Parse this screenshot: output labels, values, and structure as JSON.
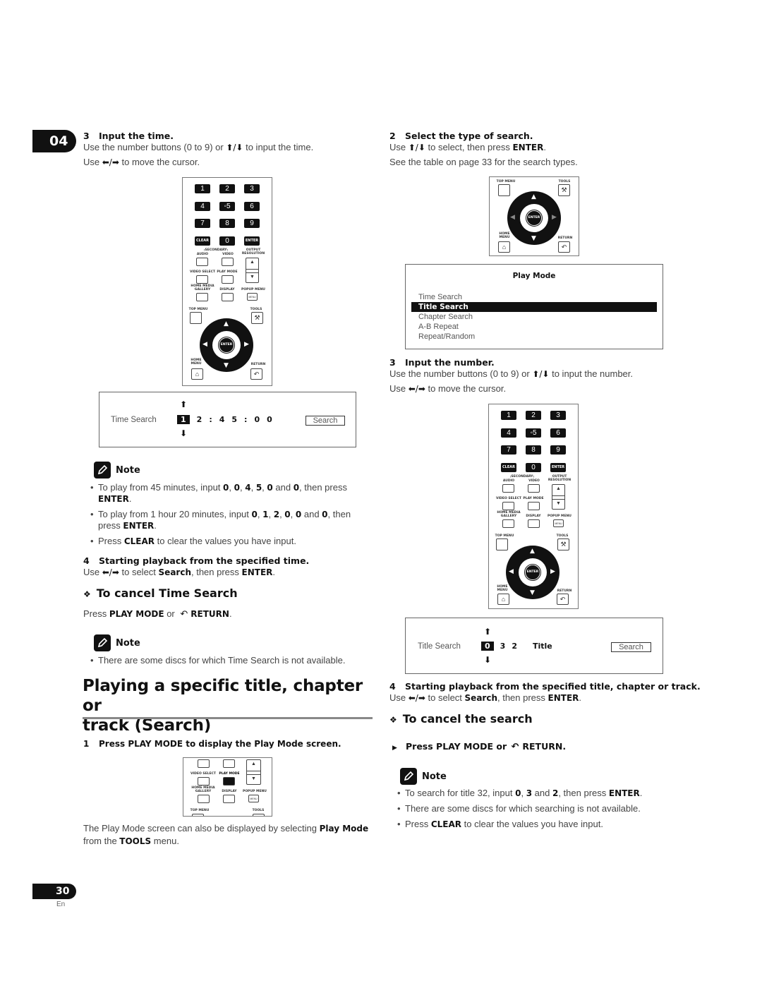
{
  "chapter": "04",
  "page": {
    "number": "30",
    "lang": "En"
  },
  "left": {
    "step3": {
      "num": "3",
      "title": "Input the time.",
      "line1_pre": "Use the number buttons (0 to 9) or ",
      "line1_arrows": "🠉/🠋",
      "line1_post": " to input the time.",
      "line2_pre": "Use ",
      "line2_arrows": "⬅/➡",
      "line2_post": " to move the cursor."
    },
    "time_screen": {
      "label": "Time Search",
      "digits": [
        "1",
        "2",
        ":",
        "4",
        "5",
        ":",
        "0",
        "0"
      ],
      "selected_index": 0,
      "up_arrow": "⬆",
      "down_arrow": "⬇",
      "button": "Search"
    },
    "note1": {
      "heading": "Note",
      "items": [
        [
          "To play from 45 minutes, input ",
          "0",
          ", ",
          "0",
          ", ",
          "4",
          ", ",
          "5",
          ", ",
          "0",
          " and ",
          "0",
          ", then press ",
          "ENTER",
          "."
        ],
        [
          "To play from 1 hour 20 minutes, input ",
          "0",
          ", ",
          "1",
          ", ",
          "2",
          ", ",
          "0",
          ", ",
          "0",
          " and ",
          "0",
          ", then press ",
          "ENTER",
          "."
        ],
        [
          "Press ",
          "CLEAR",
          " to clear the values you have input."
        ]
      ]
    },
    "step4": {
      "num": "4",
      "title": "Starting playback from the specified time.",
      "pre": "Use ",
      "arrows": "⬅/➡",
      "mid": " to select ",
      "b1": "Search",
      "mid2": ", then press ",
      "b2": "ENTER",
      "post": "."
    },
    "cancel": {
      "diamond": "❖",
      "heading": "To cancel Time Search",
      "pre": "Press ",
      "b1": "PLAY MODE",
      "mid": " or ",
      "b2": "RETURN",
      "post": "."
    },
    "note2": {
      "heading": "Note",
      "items": [
        [
          "There are some discs for which Time Search is not available."
        ]
      ]
    },
    "section_title_line1": "Playing a specific title, chapter or",
    "section_title_line2": "track (Search)",
    "step1": {
      "num": "1",
      "title": "Press PLAY MODE to display the Play Mode screen."
    },
    "footer_pre": "The Play Mode screen can also be displayed by selecting ",
    "footer_b1": "Play Mode",
    "footer_mid": " from the ",
    "footer_b2": "TOOLS",
    "footer_post": " menu."
  },
  "right": {
    "step2": {
      "num": "2",
      "title": "Select the type of search.",
      "pre": "Use ",
      "arrows": "🠉/🠋",
      "mid": " to select, then press ",
      "b1": "ENTER",
      "post": ".",
      "line2": "See the table on page 33 for the search types."
    },
    "play_mode_menu": {
      "title": "Play Mode",
      "items": [
        "Time Search",
        "Title Search",
        "Chapter Search",
        "A-B Repeat",
        "Repeat/Random"
      ],
      "selected": "Title Search"
    },
    "step3": {
      "num": "3",
      "title": "Input the number.",
      "line1_pre": "Use the number buttons (0 to 9) or ",
      "line1_arrows": "🠉/🠋",
      "line1_post": " to input the number.",
      "line2_pre": "Use ",
      "line2_arrows": "⬅/➡",
      "line2_post": " to move the cursor."
    },
    "title_screen": {
      "label": "Title Search",
      "digits": [
        "0",
        "3",
        "2"
      ],
      "selected_index": 0,
      "unit": "Title",
      "up_arrow": "⬆",
      "down_arrow": "⬇",
      "button": "Search"
    },
    "step4": {
      "num": "4",
      "title": "Starting playback from the specified title, chapter or track.",
      "pre": "Use ",
      "arrows": "⬅/➡",
      "mid": " to select ",
      "b1": "Search",
      "mid2": ", then press ",
      "b2": "ENTER",
      "post": "."
    },
    "cancel": {
      "diamond": "❖",
      "heading": "To cancel the search",
      "bullet": "▶",
      "pre": "Press PLAY MODE or ",
      "b2": "RETURN."
    },
    "note": {
      "heading": "Note",
      "items": [
        [
          "To search for title 32, input ",
          "0",
          ", ",
          "3",
          " and ",
          "2",
          ", then press ",
          "ENTER",
          "."
        ],
        [
          "There are some discs for which searching is not available."
        ],
        [
          "Press ",
          "CLEAR",
          " to clear the values you have input."
        ]
      ]
    }
  },
  "remote": {
    "number_keys": [
      "1",
      "2",
      "3",
      "4",
      "◦5",
      "6",
      "7",
      "8",
      "9"
    ],
    "clear": "CLEAR",
    "zero": "0",
    "enter": "ENTER",
    "secondary": "┌SECONDARY┐",
    "audio": "AUDIO",
    "video": "VIDEO",
    "output_resolution": "OUTPUT RESOLUTION",
    "video_select": "VIDEO SELECT",
    "play_mode": "PLAY MODE",
    "home_media_gallery": "HOME MEDIA GALLERY",
    "display": "DISPLAY",
    "popup_menu": "POPUP MENU",
    "menu": "MENU",
    "top_menu": "TOP MENU",
    "tools": "TOOLS",
    "home_menu": "HOME MENU",
    "return": "RETURN",
    "up": "▲",
    "down": "▼"
  }
}
